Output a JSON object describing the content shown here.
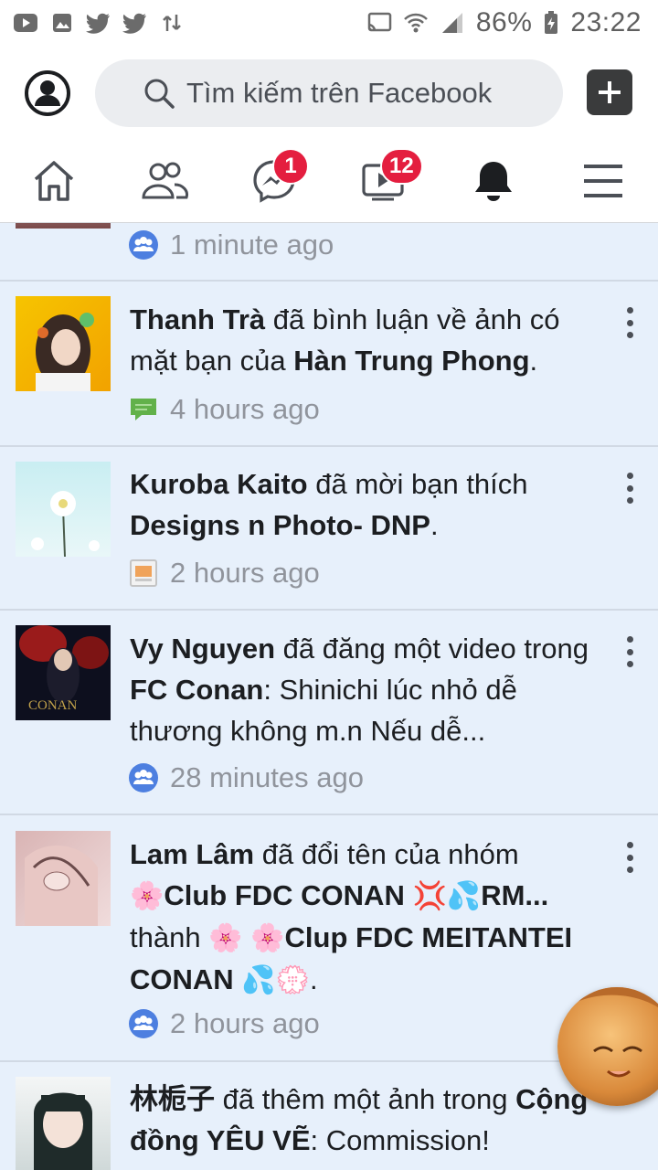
{
  "status_bar": {
    "battery": "86%",
    "time": "23:22"
  },
  "header": {
    "search_placeholder": "Tìm kiếm trên Facebook"
  },
  "nav": {
    "messenger_badge": "1",
    "watch_badge": "12"
  },
  "notifications": [
    {
      "time": "1 minute ago",
      "meta_icon": "group-icon"
    },
    {
      "actor": "Thanh Trà",
      "text1": " đã bình luận về ảnh có mặt bạn của ",
      "target": "Hàn Trung Phong",
      "text2": ".",
      "time": "4 hours ago",
      "meta_icon": "comment-icon"
    },
    {
      "actor": "Kuroba Kaito",
      "text1": " đã mời bạn thích ",
      "target": "Designs n Photo- DNP",
      "text2": ".",
      "time": "2 hours ago",
      "meta_icon": "page-icon"
    },
    {
      "actor": "Vy Nguyen",
      "text1": " đã đăng một video trong ",
      "target": "FC Conan",
      "text2": ": Shinichi lúc nhỏ dễ thương không m.n Nếu dễ...",
      "time": "28 minutes ago",
      "meta_icon": "group-icon"
    },
    {
      "actor": "Lam Lâm",
      "text1": " đã đổi tên của nhóm ",
      "old_name": "Club FDC CONAN",
      "old_suffix": "RM...",
      "text2": " thành ",
      "new_name": "Clup FDC MEITANTEI CONAN",
      "text3": ".",
      "time": "2 hours ago",
      "meta_icon": "group-icon"
    },
    {
      "actor": "林栀子",
      "text1": " đã thêm một ảnh trong ",
      "target": "Cộng đồng YÊU VẼ",
      "text2": ": Commission!"
    }
  ],
  "colors": {
    "unread_bg": "#e7f0fb",
    "badge": "#e41e3f",
    "group_icon": "#4d7fe0",
    "comment_icon": "#62b14a"
  }
}
